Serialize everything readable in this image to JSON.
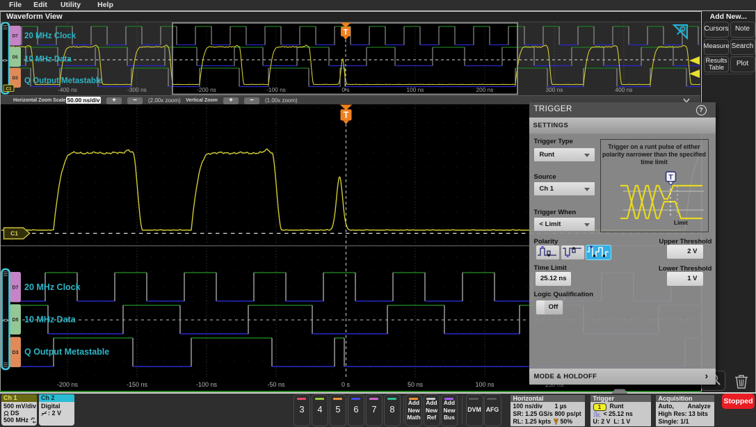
{
  "menu": {
    "items": [
      "File",
      "Edit",
      "Utility",
      "Help"
    ]
  },
  "view_tab": "Waveform View",
  "add_new": {
    "title": "Add New...",
    "buttons": [
      "Cursors",
      "Note",
      "Measure",
      "Search",
      "Results Table",
      "Plot"
    ]
  },
  "zoom_toolbar": {
    "label": "Horizontal Zoom Scale",
    "scale_value": "50.00 ns/div",
    "plus": "+",
    "minus": "−",
    "h_factor": "(2.00x zoom)",
    "v_label": "Vertical Zoom",
    "v_factor": "(1.00x zoom)"
  },
  "channels": [
    {
      "id": "D7",
      "label": "20 MHz Clock",
      "chip_color": "#c584c6"
    },
    {
      "id": "D5",
      "label": "10 MHz Data",
      "chip_color": "#94c794"
    },
    {
      "id": "D3",
      "label": "Q Output Metastable",
      "chip_color": "#e08a58"
    }
  ],
  "cursor_label": "C1",
  "trigger_marker": "T",
  "overview": {
    "ticks": [
      {
        "t": -400,
        "label": "-400 ns"
      },
      {
        "t": -300,
        "label": "-300 ns"
      },
      {
        "t": -200,
        "label": "-200 ns"
      },
      {
        "t": -100,
        "label": "-100 ns"
      },
      {
        "t": 0,
        "label": "0 s"
      },
      {
        "t": 100,
        "label": "100 ns"
      },
      {
        "t": 200,
        "label": "200 ns"
      },
      {
        "t": 300,
        "label": "300 ns"
      },
      {
        "t": 400,
        "label": "400 ns"
      }
    ]
  },
  "main_view": {
    "ticks": [
      {
        "t": -200,
        "label": "-200 ns"
      },
      {
        "t": -150,
        "label": "-150 ns"
      },
      {
        "t": -100,
        "label": "-100 ns"
      },
      {
        "t": -50,
        "label": "-50 ns"
      },
      {
        "t": 0,
        "label": "0 s"
      },
      {
        "t": 50,
        "label": "50 ns"
      },
      {
        "t": 100,
        "label": "100 ns"
      },
      {
        "t": 150,
        "label": "150 ns"
      }
    ]
  },
  "signals": {
    "clock": {
      "rise_start": -466,
      "period": 50,
      "high": 23
    },
    "data_highs": [
      [
        -460,
        -414
      ],
      [
        -360,
        -314
      ],
      [
        -260,
        -214
      ],
      [
        -160,
        -119
      ],
      [
        -70,
        -24
      ],
      [
        30,
        71
      ],
      [
        125,
        171
      ],
      [
        225,
        271
      ],
      [
        325,
        371
      ],
      [
        425,
        471
      ]
    ],
    "q_highs": [
      [
        -505,
        -453
      ],
      [
        -411,
        -356
      ],
      [
        -308,
        -255
      ],
      [
        -210,
        -153
      ],
      [
        -111,
        -53
      ],
      [
        244,
        290
      ],
      [
        342,
        390
      ],
      [
        438,
        490
      ]
    ],
    "q_runt": [
      -8,
      -1
    ],
    "analog": {
      "rise": 11,
      "fall": 7,
      "runt_center": -4.4,
      "runt_sigma": 2.2,
      "runt_amp": 0.69
    }
  },
  "trigger_panel": {
    "title": "TRIGGER",
    "help": "?",
    "tab": "SETTINGS",
    "trigger_type": {
      "label": "Trigger Type",
      "value": "Runt"
    },
    "source": {
      "label": "Source",
      "value": "Ch 1"
    },
    "trigger_when": {
      "label": "Trigger When",
      "value": "< Limit"
    },
    "polarity_label": "Polarity",
    "polarity_options": [
      "positive-runt",
      "negative-runt",
      "either-runt"
    ],
    "polarity_selected": "either-runt",
    "upper_threshold": {
      "label": "Upper Threshold",
      "value": "2 V"
    },
    "time_limit": {
      "label": "Time Limit",
      "value": "25.12 ns"
    },
    "lower_threshold": {
      "label": "Lower Threshold",
      "value": "1 V"
    },
    "logic_qualification": {
      "label": "Logic Qualification",
      "value": "Off"
    },
    "description": "Trigger on a runt pulse of either polarity narrower than the specified time limit",
    "diagram_limit_label": "Limit",
    "mode_holdoff": "MODE & HOLDOFF",
    "chevron": "›"
  },
  "bottom_bar": {
    "ch1": {
      "title": "Ch 1",
      "scale": "500 mV/div",
      "probe": "DS",
      "bandwidth": "500 MHz"
    },
    "ch2": {
      "title": "Ch 2",
      "mode": "Digital",
      "threshold": ": 2 V"
    },
    "channel_buttons": [
      {
        "label": "3",
        "color": "#e8486a"
      },
      {
        "label": "4",
        "color": "#97c93d"
      },
      {
        "label": "5",
        "color": "#f09138"
      },
      {
        "label": "6",
        "color": "#4547e8"
      },
      {
        "label": "7",
        "color": "#cc66cc"
      },
      {
        "label": "8",
        "color": "#2fbf94"
      }
    ],
    "add_buttons": [
      {
        "lines": [
          "Add",
          "New",
          "Math"
        ],
        "color": "#f09138"
      },
      {
        "lines": [
          "Add",
          "New",
          "Ref"
        ],
        "color": "#c8c8c8"
      },
      {
        "lines": [
          "Add",
          "New",
          "Bus"
        ],
        "color": "#a55cf0"
      }
    ],
    "dvm": "DVM",
    "afg": "AFG",
    "horizontal": {
      "title": "Horizontal",
      "rows": [
        [
          "100 ns/div",
          "1 µs"
        ],
        [
          "SR: 1.25 GS/s",
          "800 ps/pt"
        ],
        [
          "RL: 1.25 kpts",
          "50%"
        ]
      ]
    },
    "trigger": {
      "title": "Trigger",
      "badge": "1",
      "type": "Runt",
      "condition": "< 25.12 ns",
      "thresholds": "U: 2 V  L: 1 V"
    },
    "acquisition": {
      "title": "Acquisition",
      "row1a": "Auto,",
      "row1b": "Analyze",
      "row2": "High Res: 13 bits",
      "row3": "Single: 1/1"
    },
    "stopped": "Stopped"
  },
  "colors": {
    "trace_yellow": "#d3cc35",
    "digital_green": "#1f7a1f",
    "digital_blue": "#2929cc",
    "digital_grey": "#9a9a9a",
    "label_cyan": "#2cb5c5",
    "trigger_orange": "#f08020",
    "bracket_cyan": "#45c9dc"
  }
}
